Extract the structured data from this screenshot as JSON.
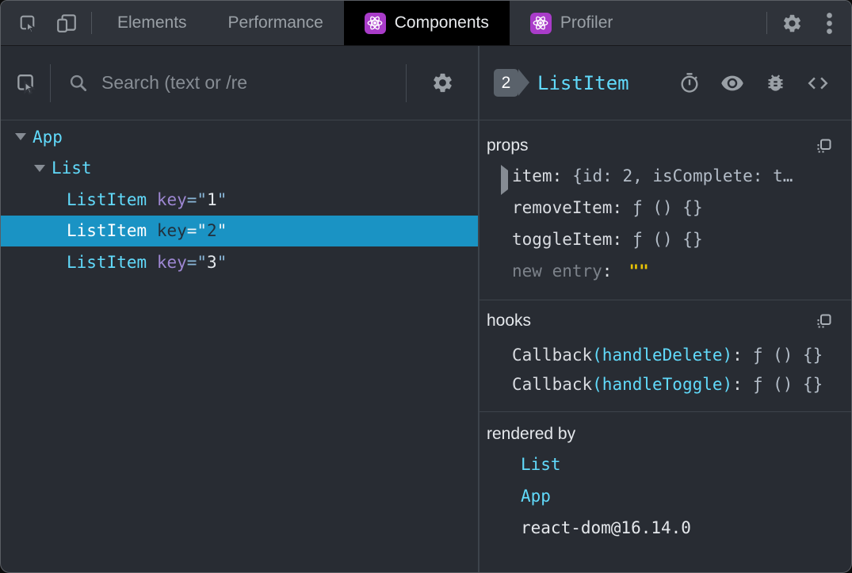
{
  "topbar": {
    "tabs": {
      "elements": "Elements",
      "performance": "Performance",
      "components": "Components",
      "profiler": "Profiler"
    }
  },
  "left": {
    "search_placeholder": "Search (text or /re",
    "tree": {
      "r0": {
        "name": "App"
      },
      "r1": {
        "name": "List"
      },
      "r2": {
        "name": "ListItem",
        "attr": "key",
        "eq": "=\"",
        "value": "1",
        "q": "\""
      },
      "r3": {
        "name": "ListItem",
        "attr": "key",
        "eq": "=\"",
        "value": "2",
        "q": "\""
      },
      "r4": {
        "name": "ListItem",
        "attr": "key",
        "eq": "=\"",
        "value": "3",
        "q": "\""
      }
    }
  },
  "right": {
    "badge": "2",
    "component": "ListItem",
    "props": {
      "title": "props",
      "r0": {
        "name": "item",
        "colon": ":",
        "value": "{id: 2, isComplete: t…"
      },
      "r1": {
        "name": "removeItem",
        "colon": ":",
        "value": "ƒ () {}"
      },
      "r2": {
        "name": "toggleItem",
        "colon": ":",
        "value": "ƒ () {}"
      },
      "r3": {
        "name": "new entry",
        "colon": ":",
        "value": "\"\""
      }
    },
    "hooks": {
      "title": "hooks",
      "r0": {
        "type": "Callback",
        "fn": "(handleDelete)",
        "colon": ":",
        "value": "ƒ () {}"
      },
      "r1": {
        "type": "Callback",
        "fn": "(handleToggle)",
        "colon": ":",
        "value": "ƒ () {}"
      }
    },
    "rendered_by": {
      "title": "rendered by",
      "r0": "List",
      "r1": "App",
      "r2": "react-dom@16.14.0"
    }
  },
  "colors": {
    "accent_cyan": "#61dafb",
    "selected_row_bg": "#1a93c4",
    "key_attr_purple": "#9d87d2",
    "editable_value_yellow": "#e9c405",
    "react_icon_purple": "#a93cc9",
    "active_tab_bg": "#000000"
  }
}
